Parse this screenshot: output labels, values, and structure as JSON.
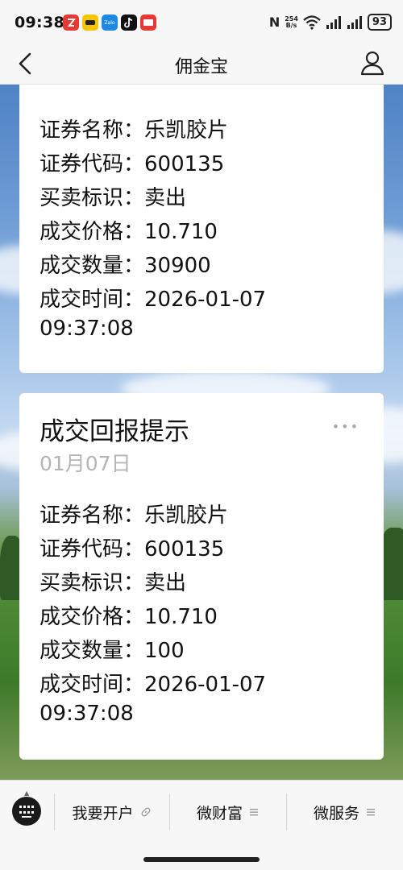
{
  "status_bar": {
    "time": "09:38",
    "app_icons": [
      {
        "name": "stock-app-icon",
        "color": "#e53935",
        "label": ""
      },
      {
        "name": "meituan-icon",
        "color": "#f7c600",
        "label": ""
      },
      {
        "name": "zalo-icon",
        "color": "#1e88e5",
        "label": "Zalo"
      },
      {
        "name": "tiktok-icon",
        "color": "#111111",
        "label": ""
      },
      {
        "name": "broker-app-icon",
        "color": "#e53935",
        "label": ""
      }
    ],
    "nfc": "N",
    "speed_top": "254",
    "speed_bottom": "B/s",
    "battery": "93"
  },
  "header": {
    "title": "佣金宝"
  },
  "cards": [
    {
      "title": "",
      "date": "",
      "lines": [
        "证券名称：乐凯胶片",
        "证券代码：600135",
        "买卖标识：卖出",
        "成交价格：10.710",
        "成交数量：30900",
        "成交时间：2026-01-07",
        "09:37:08"
      ]
    },
    {
      "title": "成交回报提示",
      "date": "01月07日",
      "more": "•••",
      "lines": [
        "证券名称：乐凯胶片",
        "证券代码：600135",
        "买卖标识：卖出",
        "成交价格：10.710",
        "成交数量：100",
        "成交时间：2026-01-07",
        "09:37:08"
      ]
    }
  ],
  "bottom_menu": {
    "items": [
      {
        "label": "我要开户",
        "icon": "link-icon"
      },
      {
        "label": "微财富",
        "icon": "menu-lines-icon"
      },
      {
        "label": "微服务",
        "icon": "menu-lines-icon"
      }
    ]
  }
}
